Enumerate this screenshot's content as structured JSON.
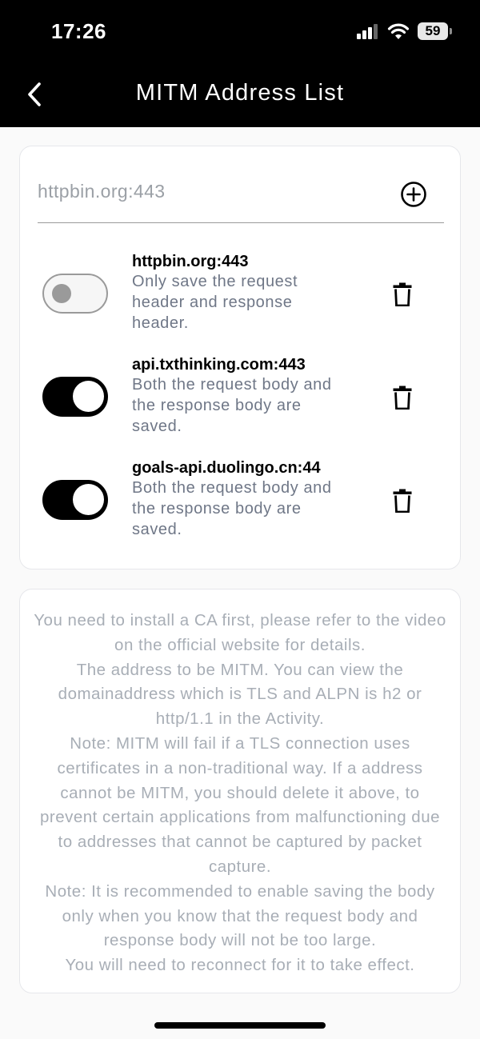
{
  "status_bar": {
    "time": "17:26",
    "battery": "59",
    "icons": [
      "cellular-signal-icon",
      "wifi-icon",
      "battery-icon"
    ]
  },
  "nav": {
    "title": "MITM Address List",
    "back_icon": "chevron-left-icon"
  },
  "address_input": {
    "value": "",
    "placeholder": "httpbin.org:443",
    "add_icon": "plus-circle-icon"
  },
  "items": [
    {
      "address": "httpbin.org:443",
      "description": "Only save the request header and response header.",
      "enabled": false,
      "delete_icon": "trash-icon"
    },
    {
      "address": "api.txthinking.com:443",
      "description": "Both the request body and the response body are saved.",
      "enabled": true,
      "delete_icon": "trash-icon"
    },
    {
      "address": "goals-api.duolingo.cn:44",
      "description": "Both the request body and the response body are saved.",
      "enabled": true,
      "delete_icon": "trash-icon"
    }
  ],
  "info": {
    "lines": [
      "You need to install a CA first, please refer to the video on the official website for details.",
      "The address to be MITM. You can view the domainaddress which is TLS and ALPN is h2 or http/1.1 in the Activity.",
      "Note: MITM will fail if a TLS connection uses certificates in a non-traditional way. If a address cannot be MITM, you should delete it above, to prevent certain applications from malfunctioning due to addresses that cannot be captured by packet capture.",
      "Note: It is recommended to enable saving the body only when you know that the request body and response body will not be too large.",
      "You will need to reconnect for it to take effect."
    ]
  },
  "colors": {
    "header_bg": "#000000",
    "toggle_on": "#000000",
    "toggle_off_border": "#9a9a9a",
    "description_text": "#6f7787",
    "info_text": "#a8aeb6",
    "card_border": "#e6e7eb"
  }
}
